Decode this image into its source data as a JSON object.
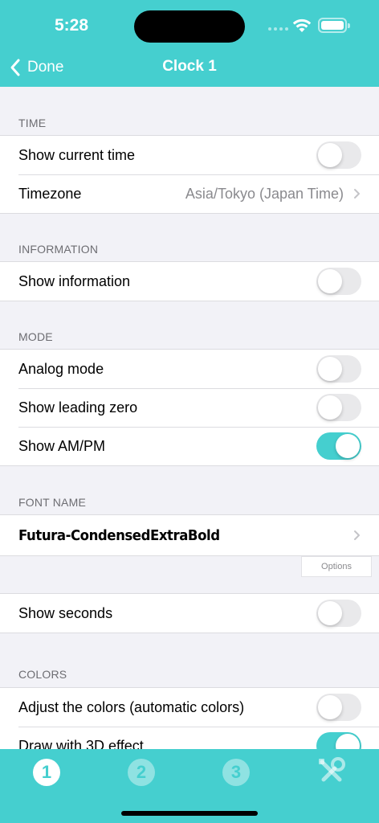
{
  "status_bar": {
    "time": "5:28"
  },
  "nav": {
    "back_label": "Done",
    "title": "Clock 1"
  },
  "sections": {
    "time": {
      "header": "TIME",
      "show_current_time": {
        "label": "Show current time",
        "on": false
      },
      "timezone": {
        "label": "Timezone",
        "value": "Asia/Tokyo (Japan Time)"
      }
    },
    "information": {
      "header": "INFORMATION",
      "show_information": {
        "label": "Show information",
        "on": false
      }
    },
    "mode": {
      "header": "MODE",
      "analog_mode": {
        "label": "Analog mode",
        "on": false
      },
      "show_leading_zero": {
        "label": "Show leading zero",
        "on": false
      },
      "show_ampm": {
        "label": "Show AM/PM",
        "on": true
      }
    },
    "font_name": {
      "header": "FONT NAME",
      "font": {
        "label": "Futura-CondensedExtraBold"
      },
      "options_label": "Options"
    },
    "seconds": {
      "show_seconds": {
        "label": "Show seconds",
        "on": false
      }
    },
    "colors": {
      "header": "COLORS",
      "adjust_colors": {
        "label": "Adjust the colors (automatic colors)",
        "on": false
      },
      "draw_3d": {
        "label": "Draw with 3D effect",
        "on": true
      }
    }
  },
  "tabbar": {
    "tabs": [
      {
        "label": "1",
        "active": true
      },
      {
        "label": "2",
        "active": false
      },
      {
        "label": "3",
        "active": false
      }
    ],
    "tools_icon": "tools-icon"
  },
  "colors": {
    "accent": "#45cfcf",
    "background": "#f2f2f7",
    "text": "#000000",
    "secondary_text": "#8a8a8e"
  }
}
